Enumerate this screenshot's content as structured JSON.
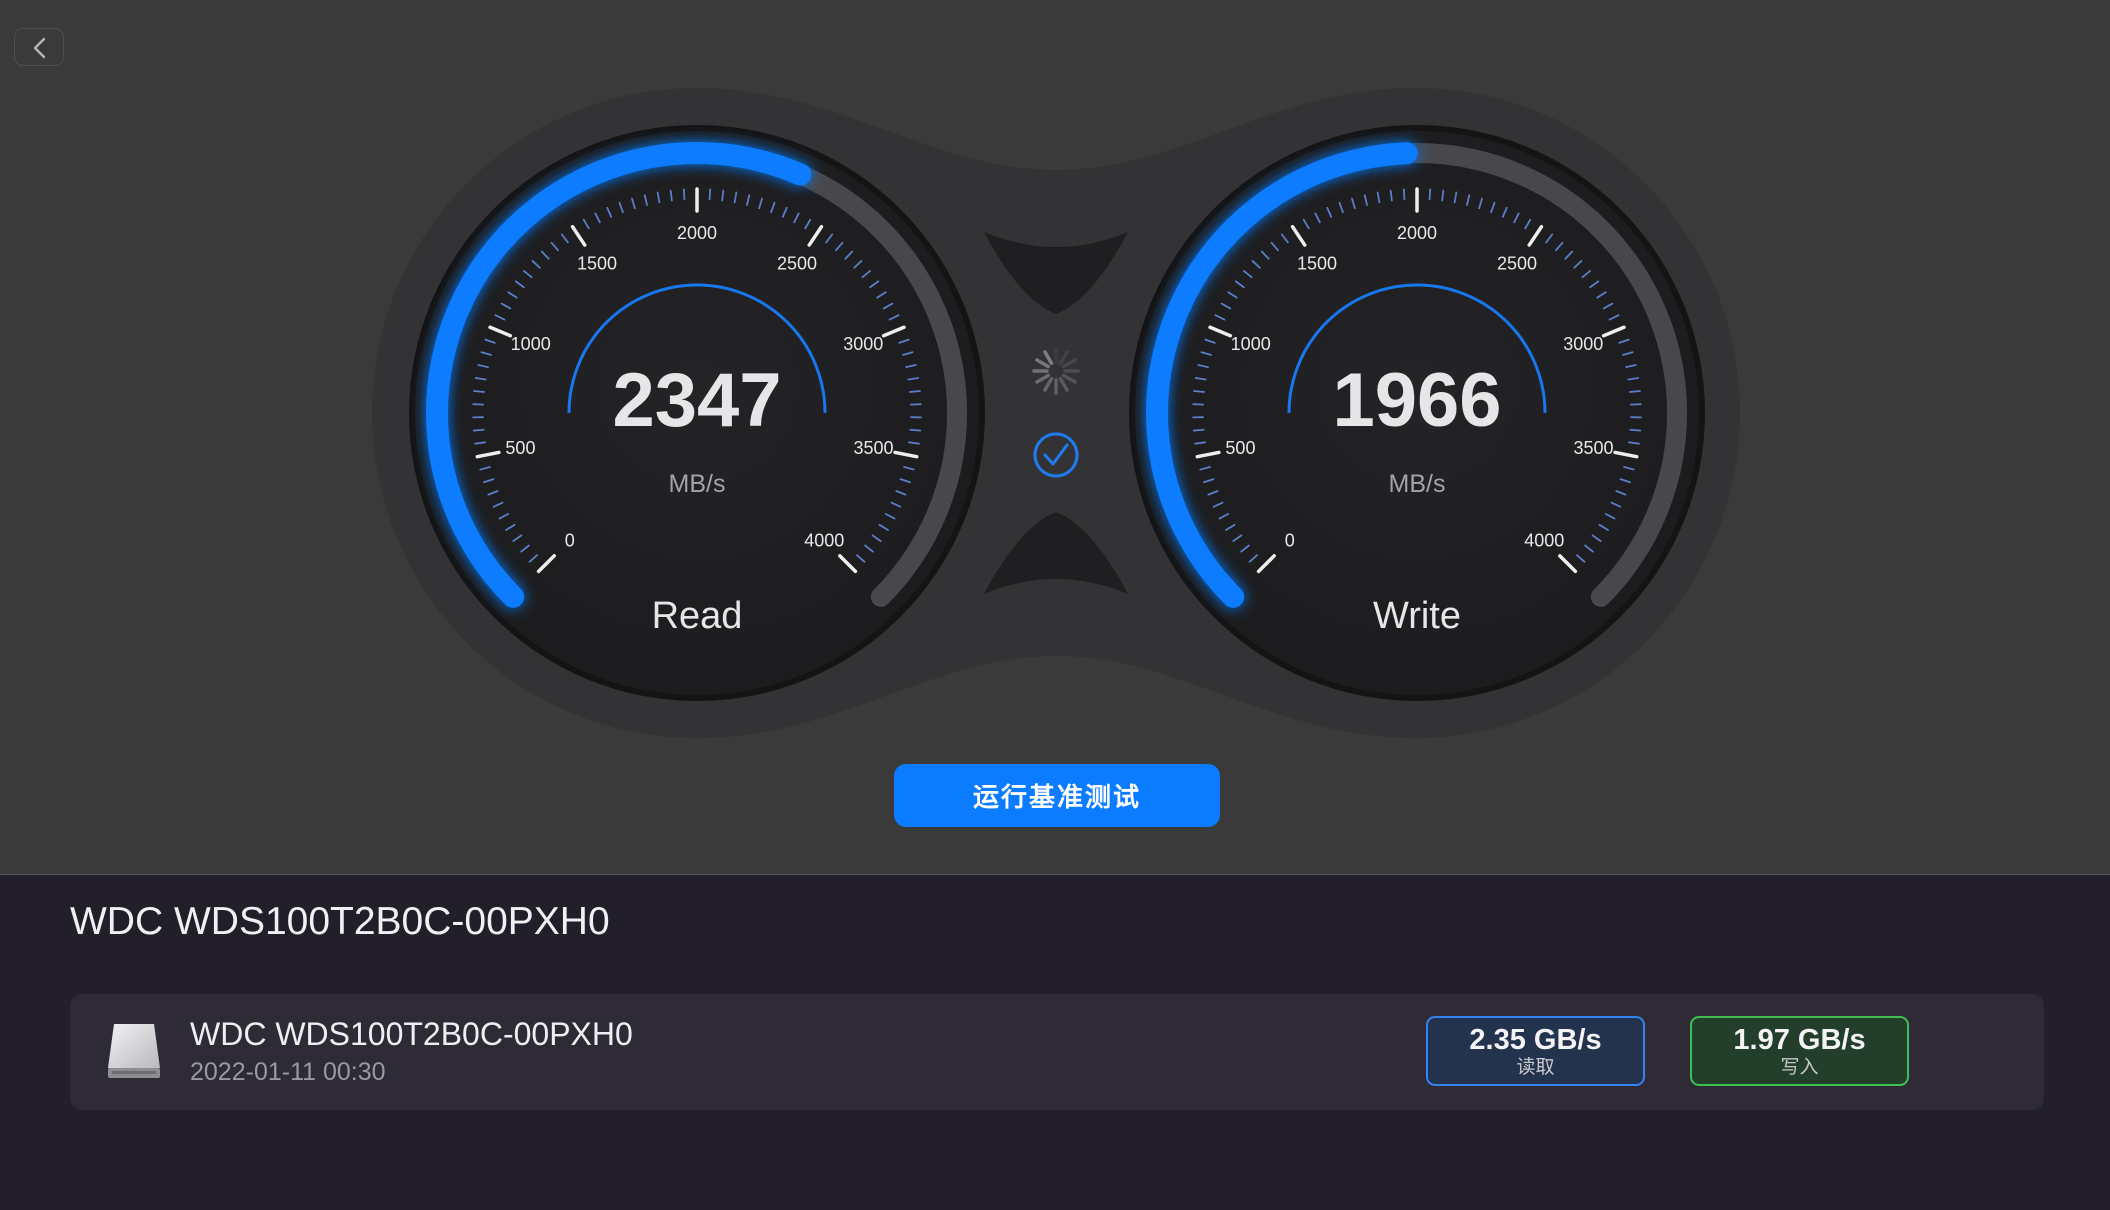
{
  "gauges": {
    "scale_labels": [
      "0",
      "500",
      "1000",
      "1500",
      "2000",
      "2500",
      "3000",
      "3500",
      "4000"
    ],
    "scale_max": 4000,
    "unit": "MB/s",
    "read": {
      "value": 2347,
      "value_text": "2347",
      "label": "Read"
    },
    "write": {
      "value": 1966,
      "value_text": "1966",
      "label": "Write"
    }
  },
  "status": {
    "loading_icon": "spinner-icon",
    "done_icon": "check-circle-icon"
  },
  "actions": {
    "run_benchmark_label": "运行基准测试"
  },
  "device": {
    "title": "WDC WDS100T2B0C-00PXH0",
    "result": {
      "name": "WDC WDS100T2B0C-00PXH0",
      "date": "2022-01-11 00:30",
      "read_speed": "2.35 GB/s",
      "read_label": "读取",
      "write_speed": "1.97 GB/s",
      "write_label": "写入"
    }
  },
  "colors": {
    "accent": "#0b7cff",
    "read_badge_border": "#3483f0",
    "write_badge_border": "#3fbf52"
  }
}
